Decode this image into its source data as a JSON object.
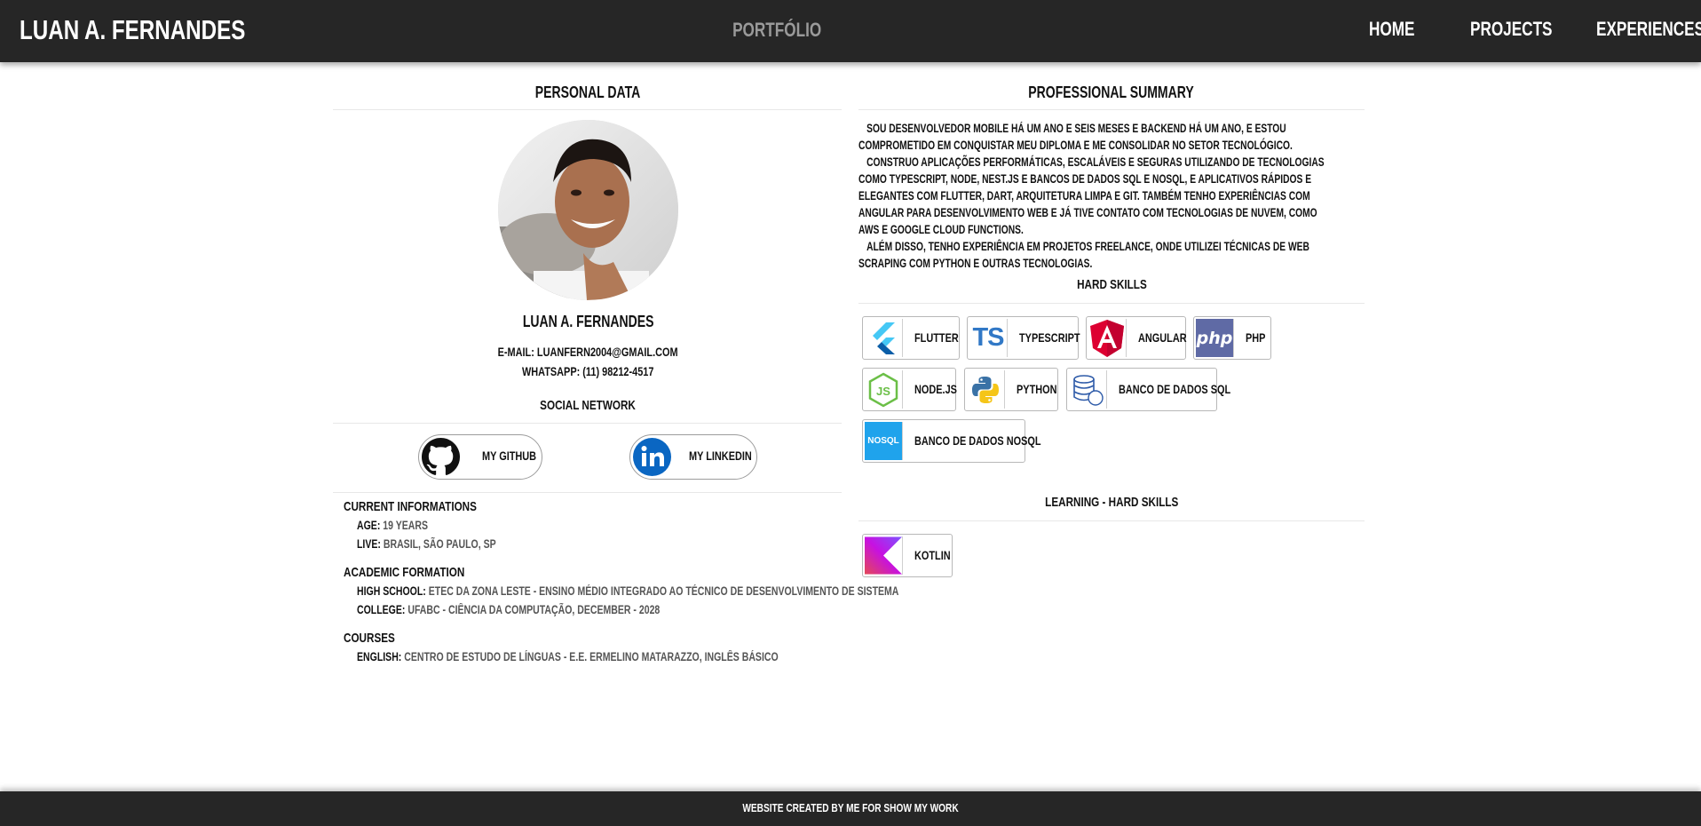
{
  "header": {
    "brand": "LUAN A. FERNANDES",
    "center_title": "PORTFÓLIO",
    "nav": [
      "HOME",
      "PROJECTS",
      "EXPERIENCES"
    ]
  },
  "personal": {
    "section_title": "PERSONAL DATA",
    "name": "LUAN A. FERNANDES",
    "email": "E-MAIL: LUANFERN2004@GMAIL.COM",
    "whatsapp": "WHATSAPP: (11) 98212-4517"
  },
  "social": {
    "section_title": "SOCIAL NETWORK",
    "github_label": "MY GITHUB",
    "linkedin_label": "MY LINKEDIN"
  },
  "current": {
    "title": "CURRENT INFORMATIONS",
    "age_key": "AGE:",
    "age_val": "19 YEARS",
    "live_key": "LIVE:",
    "live_val": "BRASIL, SÃO PAULO, SP"
  },
  "academic": {
    "title": "ACADEMIC FORMATION",
    "hs_key": "HIGH SCHOOL:",
    "hs_val": "ETEC DA ZONA LESTE - ENSINO MÉDIO INTEGRADO AO TÉCNICO DE DESENVOLVIMENTO DE SISTEMA",
    "college_key": "COLLEGE:",
    "college_val": "UFABC - CIÊNCIA DA COMPUTAÇÃO, DECEMBER - 2028"
  },
  "courses": {
    "title": "COURSES",
    "english_key": "ENGLISH:",
    "english_val": "CENTRO DE ESTUDO DE LÍNGUAS - E.E. ERMELINO MATARAZZO, INGLÊS BÁSICO"
  },
  "summary": {
    "section_title": "PROFESSIONAL SUMMARY",
    "p1": "SOU DESENVOLVEDOR MOBILE HÁ UM ANO E SEIS MESES E BACKEND HÁ UM ANO, E ESTOU COMPROMETIDO EM CONQUISTAR MEU DIPLOMA E ME CONSOLIDAR NO SETOR TECNOLÓGICO.",
    "p2": "CONSTRUO APLICAÇÕES PERFORMÁTICAS, ESCALÁVEIS E SEGURAS UTILIZANDO DE TECNOLOGIAS COMO TYPESCRIPT, NODE, NEST.JS E BANCOS DE DADOS SQL E NOSQL, E APLICATIVOS RÁPIDOS E ELEGANTES COM FLUTTER, DART, ARQUITETURA LIMPA E GIT. TAMBÉM TENHO EXPERIÊNCIAS COM ANGULAR PARA DESENVOLVIMENTO WEB E JÁ TIVE CONTATO COM TECNOLOGIAS DE NUVEM, COMO AWS E GOOGLE CLOUD FUNCTIONS.",
    "p3": "ALÉM DISSO, TENHO EXPERIÊNCIA EM PROJETOS FREELANCE, ONDE UTILIZEI TÉCNICAS DE WEB SCRAPING COM PYTHON E OUTRAS TECNOLOGIAS."
  },
  "hard_skills": {
    "section_title": "HARD SKILLS",
    "items": [
      {
        "label": "FLUTTER",
        "icon": "flutter-icon"
      },
      {
        "label": "TYPESCRIPT",
        "icon": "typescript-icon"
      },
      {
        "label": "ANGULAR",
        "icon": "angular-icon"
      },
      {
        "label": "PHP",
        "icon": "php-icon"
      },
      {
        "label": "NODE.JS",
        "icon": "nodejs-icon"
      },
      {
        "label": "PYTHON",
        "icon": "python-icon"
      },
      {
        "label": "BANCO DE DADOS SQL",
        "icon": "sql-database-icon"
      },
      {
        "label": "BANCO DE DADOS NOSQL",
        "icon": "nosql-icon"
      }
    ]
  },
  "learning": {
    "section_title": "LEARNING - HARD SKILLS",
    "items": [
      {
        "label": "KOTLIN",
        "icon": "kotlin-icon"
      }
    ]
  },
  "icon_text": {
    "ts": "TS",
    "php": "php",
    "js": "JS",
    "nosql": "NOSQL"
  },
  "footer": {
    "text": "WEBSITE CREATED BY ME FOR SHOW MY WORK"
  },
  "colors": {
    "header_bg": "#262626",
    "nav_muted": "#9a9a9a",
    "typescript_blue": "#3178c6",
    "angular_red": "#dd0031",
    "php_purple": "#5f6aa5",
    "node_green": "#6bbf47",
    "linkedin_blue": "#0a66c2",
    "nosql_blue": "#1fa3ec"
  }
}
